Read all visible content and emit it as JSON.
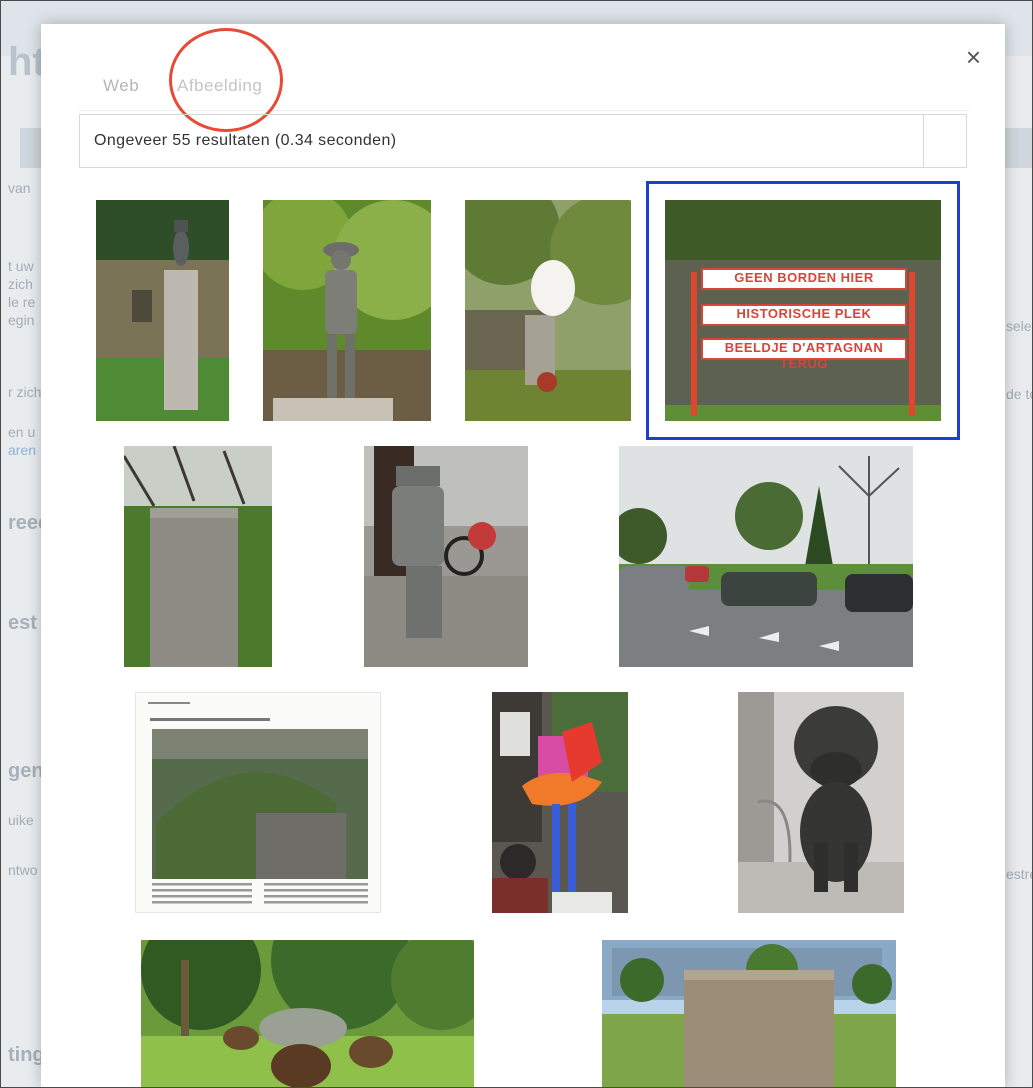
{
  "background": {
    "fragments": [
      {
        "text": "ht"
      },
      {
        "text": "van"
      },
      {
        "text": "t uw"
      },
      {
        "text": "zich"
      },
      {
        "text": "le re"
      },
      {
        "text": "egin"
      },
      {
        "text": "r zich"
      },
      {
        "text": "en u"
      },
      {
        "text": "aren"
      },
      {
        "text": "reed"
      },
      {
        "text": "est"
      },
      {
        "text": "gen"
      },
      {
        "text": "uike"
      },
      {
        "text": "ntwo"
      },
      {
        "text": "ting"
      },
      {
        "text": "sele"
      },
      {
        "text": "de to"
      },
      {
        "text": "estre"
      }
    ]
  },
  "modal": {
    "close_label": "×",
    "tabs": [
      {
        "label": "Web"
      },
      {
        "label": "Afbeelding"
      }
    ],
    "results_text": "Ongeveer 55 resultaten (0.34 seconden)"
  },
  "images": {
    "sign_lines": [
      "GEEN BORDEN HIER",
      "HISTORISCHE PLEK",
      "BEELDJE D'ARTAGNAN TERUG"
    ]
  },
  "colors": {
    "annotation_circle": "#e84a36",
    "selection_box": "#1f3fd0",
    "sign_red": "#d8443a"
  }
}
